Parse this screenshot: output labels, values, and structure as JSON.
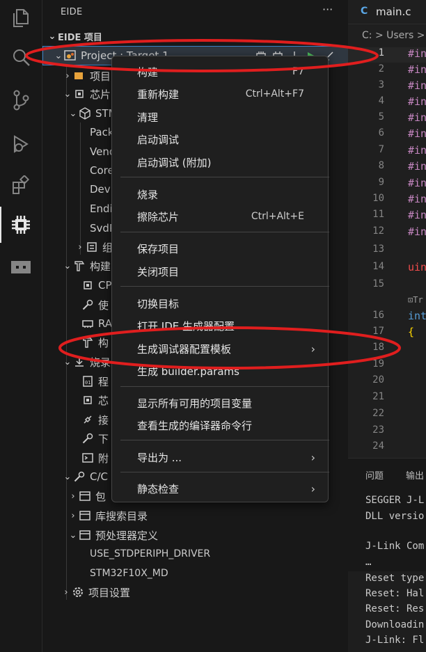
{
  "activity_bar": {
    "items": [
      "explorer-icon",
      "search-icon",
      "source-control-icon",
      "run-debug-icon",
      "extensions-icon",
      "eide-chip-icon",
      "remote-explorer-icon"
    ],
    "active": "eide-chip-icon"
  },
  "sidebar": {
    "title": "EIDE",
    "more_label": "···",
    "section": "EIDE 项目",
    "project_row": "Project : Target 1",
    "rows": {
      "xiang": "项目",
      "xin": "芯片",
      "st": "STM",
      "pack": "Pack",
      "vend": "Vend",
      "core": "Core",
      "devi": "Devi",
      "endi": "Endi",
      "svd": "SvdP",
      "zu": "组",
      "gou": "构建",
      "cpu": "CP",
      "shi": "使",
      "ram": "RA",
      "gou2": "构",
      "shao": "烧录",
      "cheng": "程",
      "xin2": "芯",
      "jie": "接",
      "xia": "下",
      "fu": "附",
      "cc": "C/C",
      "bao": "包",
      "lib_search": "库搜索目录",
      "preproc": "预处理器定义",
      "def1": "USE_STDPERIPH_DRIVER",
      "def2": "STM32F10X_MD",
      "settings": "项目设置"
    }
  },
  "editor": {
    "tab_lang": "C",
    "tab_name": "main.c",
    "breadcrumb": "C: > Users >",
    "line_numbers": [
      "1",
      "2",
      "3",
      "4",
      "5",
      "6",
      "7",
      "8",
      "9",
      "10",
      "11",
      "12",
      "13",
      "14",
      "15",
      "16",
      "17",
      "18",
      "19",
      "20",
      "21",
      "22",
      "23",
      "24"
    ],
    "code_inc": "#in",
    "code_uint": "uin",
    "code_codelens": "⊡Tr",
    "code_int": "int",
    "code_brace": "{"
  },
  "panel": {
    "tab_problems": "问题",
    "tab_output": "输出",
    "lines": [
      "SEGGER J-L",
      "DLL versio",
      "",
      "J-Link Com",
      " …",
      "Reset type",
      "Reset: Hal",
      "Reset: Res",
      "Downloadin",
      "J-Link: Fl"
    ]
  },
  "context_menu": {
    "build": "构建",
    "build_key": "F7",
    "rebuild": "重新构建",
    "rebuild_key": "Ctrl+Alt+F7",
    "clean": "清理",
    "start_debug": "启动调试",
    "start_debug_attach": "启动调试 (附加)",
    "flash": "烧录",
    "erase": "擦除芯片",
    "erase_key": "Ctrl+Alt+E",
    "save_project": "保存项目",
    "close_project": "关闭项目",
    "switch_target": "切换目标",
    "open_cubemx": "打开 IDE 生成器配置",
    "gen_debug_template": "生成调试器配置模板",
    "gen_builder_params": "生成 builder.params",
    "show_vars": "显示所有可用的项目变量",
    "show_compiler_cmd": "查看生成的编译器命令行",
    "export_as": "导出为 ...",
    "static_check": "静态检查",
    "submenu_arrow": "›"
  },
  "colors": {
    "annotation": "#e01e1e",
    "accent": "#3b82c4"
  }
}
